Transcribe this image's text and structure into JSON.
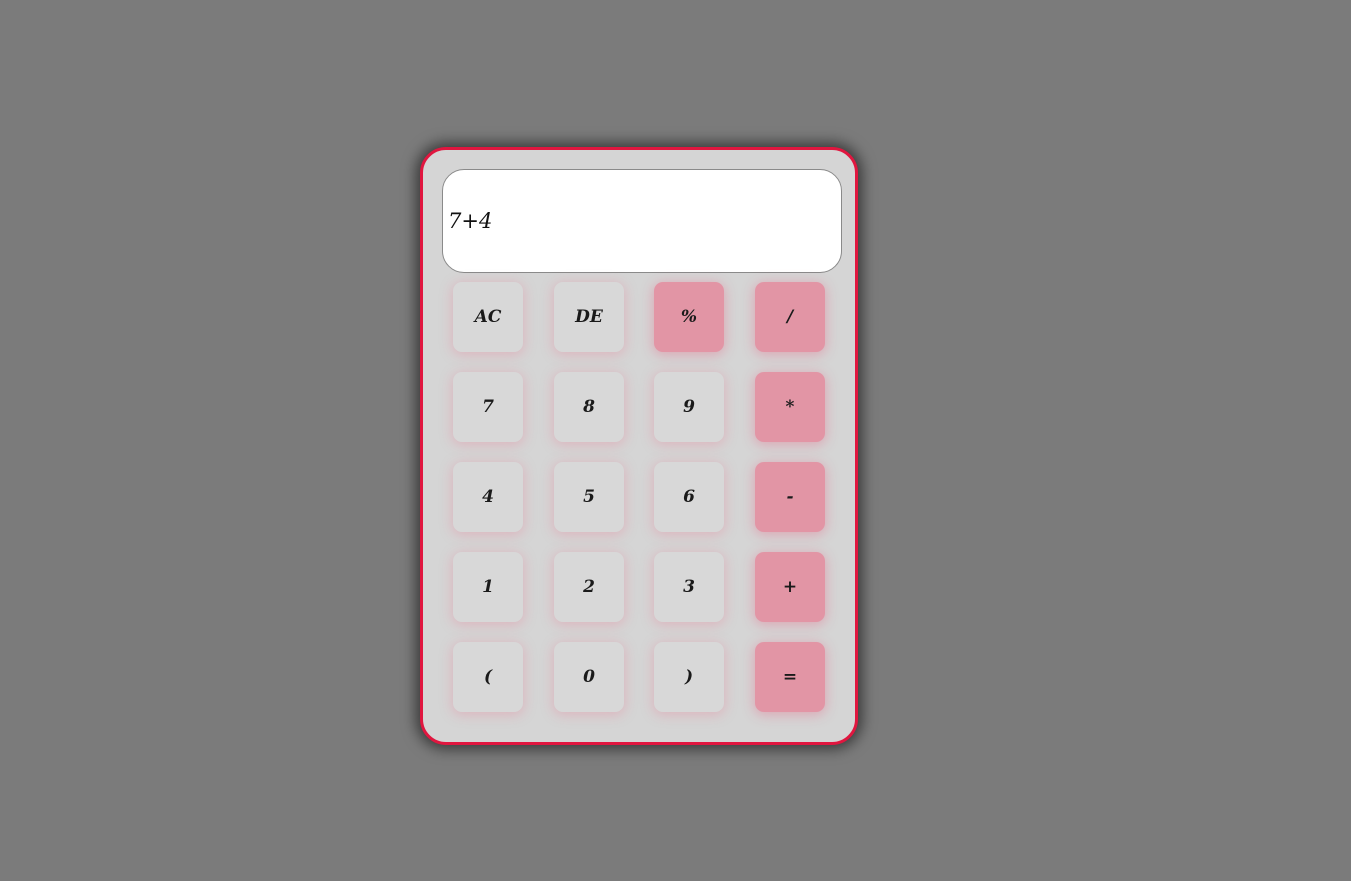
{
  "display": {
    "value": "7+4"
  },
  "colors": {
    "page_background": "#7b7b7b",
    "body_background": "#d5d5d5",
    "border_accent": "#e0163f",
    "operator_key": "#e295a5",
    "number_key": "#d8d8d8",
    "display_background": "#ffffff"
  },
  "keys": {
    "clear": "AC",
    "delete": "DE",
    "percent": "%",
    "divide": "/",
    "seven": "7",
    "eight": "8",
    "nine": "9",
    "multiply": "*",
    "four": "4",
    "five": "5",
    "six": "6",
    "subtract": "-",
    "one": "1",
    "two": "2",
    "three": "3",
    "add": "+",
    "open_paren": "(",
    "zero": "0",
    "close_paren": ")",
    "equals": "="
  }
}
